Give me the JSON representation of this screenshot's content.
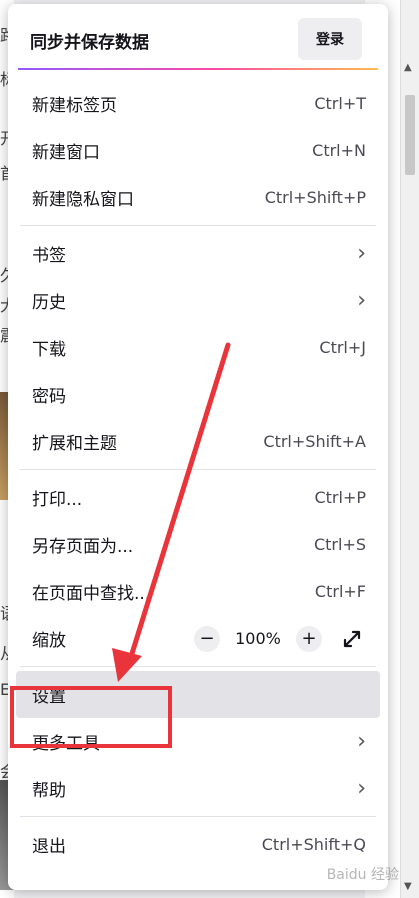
{
  "header": {
    "title": "同步并保存数据",
    "login_label": "登录"
  },
  "group1": [
    {
      "label": "新建标签页",
      "shortcut": "Ctrl+T"
    },
    {
      "label": "新建窗口",
      "shortcut": "Ctrl+N"
    },
    {
      "label": "新建隐私窗口",
      "shortcut": "Ctrl+Shift+P"
    }
  ],
  "group2": [
    {
      "label": "书签",
      "submenu": true
    },
    {
      "label": "历史",
      "submenu": true
    },
    {
      "label": "下载",
      "shortcut": "Ctrl+J"
    },
    {
      "label": "密码"
    },
    {
      "label": "扩展和主题",
      "shortcut": "Ctrl+Shift+A"
    }
  ],
  "group3": [
    {
      "label": "打印...",
      "shortcut": "Ctrl+P"
    },
    {
      "label": "另存页面为...",
      "shortcut": "Ctrl+S"
    },
    {
      "label": "在页面中查找...",
      "shortcut": "Ctrl+F"
    }
  ],
  "zoom": {
    "label": "缩放",
    "minus": "−",
    "value": "100%",
    "plus": "+",
    "fullscreen_icon": "expand-arrows-icon"
  },
  "group4": [
    {
      "label": "设置",
      "highlighted": true
    },
    {
      "label": "更多工具",
      "submenu": true
    },
    {
      "label": "帮助",
      "submenu": true
    }
  ],
  "quit": {
    "label": "退出",
    "shortcut": "Ctrl+Shift+Q"
  },
  "chevron_glyph": "›",
  "watermark": "Baidu 经验",
  "colors": {
    "highlight": "#e2e2e7",
    "annotation": "#e8343a",
    "accent_gradient": [
      "#9059ff",
      "#ff4aa2",
      "#ffbd4f"
    ]
  },
  "background": {
    "left_glyphs": [
      "路",
      "标",
      "开",
      "首",
      "久",
      "大",
      "震",
      "语",
      "从",
      "E",
      "会"
    ]
  }
}
